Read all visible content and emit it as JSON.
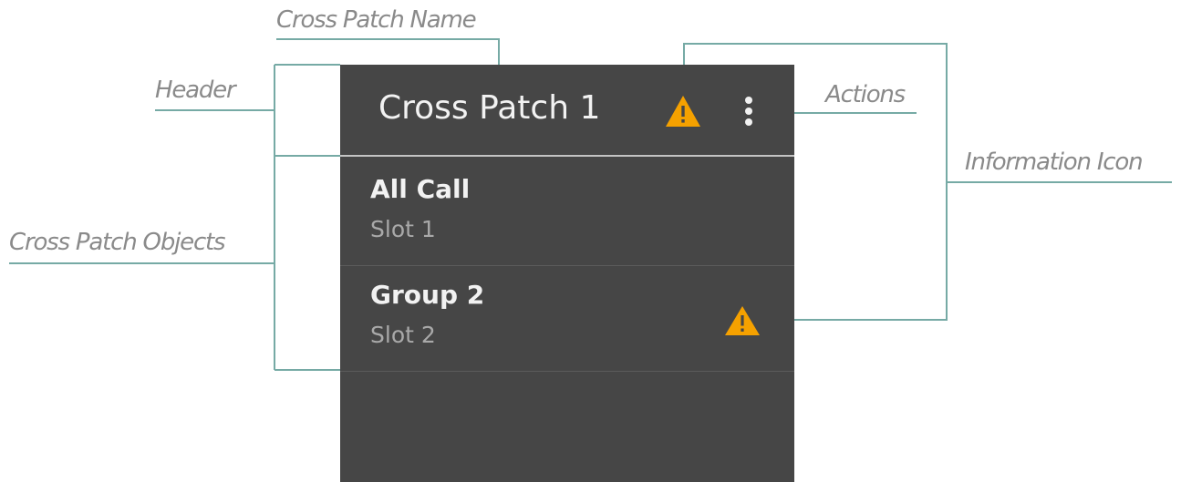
{
  "annotations": {
    "header": "Header",
    "cross_patch_objects": "Cross Patch Objects",
    "cross_patch_name": "Cross Patch Name",
    "actions": "Actions",
    "information_icon": "Information Icon"
  },
  "panel": {
    "name": "Cross Patch 1",
    "header_icon": "warning-icon",
    "actions_icon": "more-vert-icon",
    "objects": [
      {
        "name": "All Call",
        "slot": "Slot 1",
        "icon": ""
      },
      {
        "name": "Group 2",
        "slot": "Slot 2",
        "icon": "warning-icon"
      }
    ]
  },
  "colors": {
    "panel_bg": "#464646",
    "warning": "#f5a100",
    "connector": "#76aaa5",
    "annotation_text": "#8a8a8a",
    "primary_text": "#f2f2f2",
    "secondary_text": "#a9a9a9"
  }
}
